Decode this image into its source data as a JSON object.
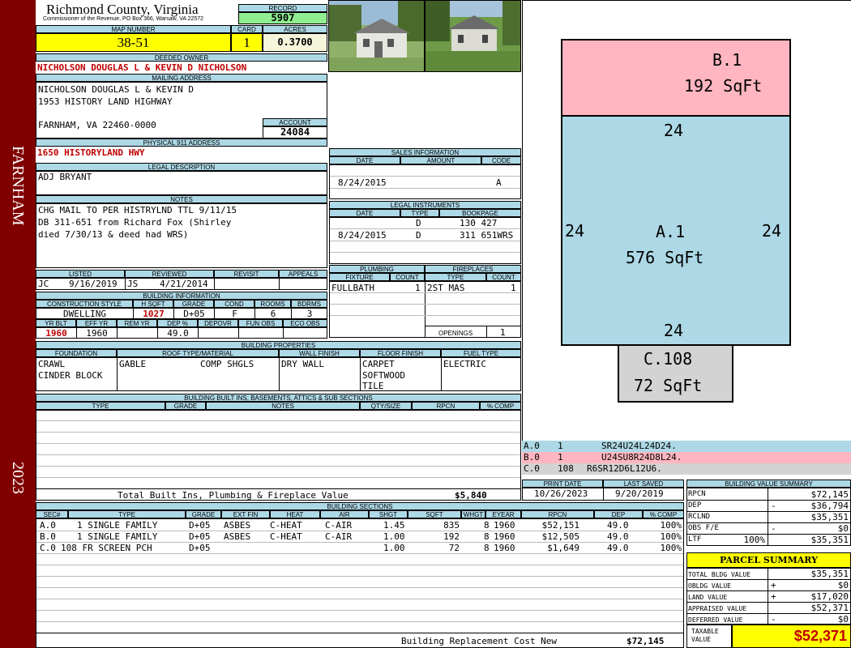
{
  "sidebar": {
    "town": "FARNHAM",
    "year": "2023"
  },
  "header": {
    "county": "Richmond County, Virginia",
    "commissioner": "Commissioner of the Revenue, PO Box 366, Warsaw, VA 22572",
    "record_label": "RECORD",
    "record": "5907",
    "map_number_label": "MAP NUMBER",
    "map_number": "38-51",
    "card_label": "CARD",
    "card": "1",
    "acres_label": "ACRES",
    "acres": "0.3700"
  },
  "owner": {
    "deeded_owner_label": "DEEDED OWNER",
    "deeded_owner": "NICHOLSON DOUGLAS L & KEVIN D NICHOLSON",
    "mailing_label": "MAILING ADDRESS",
    "mailing_lines": [
      "NICHOLSON DOUGLAS L & KEVIN D",
      "1953 HISTORY LAND HIGHWAY",
      "",
      "FARNHAM, VA 22460-0000"
    ],
    "account_label": "ACCOUNT",
    "account": "24084",
    "physical_label": "PHYSICAL 911 ADDRESS",
    "physical": "1650 HISTORYLAND HWY"
  },
  "legal": {
    "label": "LEGAL DESCRIPTION",
    "text": "ADJ BRYANT"
  },
  "notes": {
    "label": "NOTES",
    "lines": [
      "CHG MAIL TO PER HISTRYLND TTL 9/11/15",
      "DB 311-651 from Richard Fox (Shirley",
      "died 7/30/13 & deed had WRS)"
    ]
  },
  "review": {
    "listed_label": "LISTED",
    "reviewed_label": "REVIEWED",
    "revisit_label": "REVISIT",
    "appeals_label": "APPEALS",
    "listed_by": "JC",
    "listed_date": "9/16/2019",
    "reviewed_by": "JS",
    "reviewed_date": "4/21/2014"
  },
  "building_info": {
    "label": "BUILDING INFORMATION",
    "headers": [
      "CONSTRUCTION STYLE",
      "H SQFT",
      "GRADE",
      "COND",
      "ROOMS",
      "BDRMS"
    ],
    "style": "DWELLING",
    "hsqft": "1027",
    "grade": "D+05",
    "cond": "F",
    "rooms": "6",
    "bdrms": "3",
    "headers2": [
      "YR BLT",
      "EFF YR",
      "REM YR",
      "DEP %",
      "DEPOVR",
      "FUN OBS",
      "ECO OBS"
    ],
    "yr_blt": "1960",
    "eff_yr": "1960",
    "rem_yr": "",
    "dep_pct": "49.0"
  },
  "sales": {
    "label": "SALES INFORMATION",
    "headers": [
      "DATE",
      "AMOUNT",
      "CODE"
    ],
    "rows": [
      {
        "date": "8/24/2015",
        "amount": "",
        "code": "A"
      }
    ]
  },
  "instruments": {
    "label": "LEGAL INSTRUMENTS",
    "headers": [
      "DATE",
      "TYPE",
      "BOOKPAGE"
    ],
    "rows": [
      {
        "date": "",
        "type": "D",
        "book": "130 427"
      },
      {
        "date": "8/24/2015",
        "type": "D",
        "book": "311 651WRS"
      }
    ]
  },
  "plumbing": {
    "label": "PLUMBING",
    "headers": [
      "FIXTURE",
      "COUNT"
    ],
    "rows": [
      {
        "fixture": "FULLBATH",
        "count": "1"
      }
    ]
  },
  "fireplaces": {
    "label": "FIREPLACES",
    "headers": [
      "TYPE",
      "COUNT"
    ],
    "rows": [
      {
        "type": "2ST MAS",
        "count": "1"
      }
    ],
    "openings_label": "OPENINGS",
    "openings": "1"
  },
  "properties": {
    "label": "BUILDING PROPERTIES",
    "headers": [
      "FOUNDATION",
      "ROOF TYPE/MATERIAL",
      "WALL FINISH",
      "FLOOR FINISH",
      "FUEL TYPE"
    ],
    "foundation": [
      "CRAWL",
      "CINDER BLOCK"
    ],
    "roof_type": "GABLE",
    "roof_material": "COMP SHGLS",
    "wall": "DRY WALL",
    "floor": [
      "CARPET",
      "SOFTWOOD",
      "TILE"
    ],
    "fuel": "ELECTRIC"
  },
  "builtins": {
    "label": "BUILDING BUILT INS, BASEMENTS, ATTICS & SUB SECTIONS",
    "headers": [
      "TYPE",
      "GRADE",
      "NOTES",
      "QTY/SIZE",
      "RPCN",
      "% COMP"
    ],
    "total_label": "Total Built Ins, Plumbing & Fireplace Value",
    "total": "$5,840"
  },
  "print": {
    "print_label": "PRINT DATE",
    "saved_label": "LAST SAVED",
    "print_date": "10/26/2023",
    "last_saved": "9/20/2019"
  },
  "sketch": {
    "sections": [
      {
        "code": "B.1",
        "area": "192 SqFt",
        "color": "#ffb6c1"
      },
      {
        "code": "A.1",
        "area": "576 SqFt",
        "color": "#add8e6"
      },
      {
        "code": "C.108",
        "area": "72 SqFt",
        "color": "#d3d3d3"
      }
    ],
    "dims": {
      "top": "24",
      "left": "24",
      "right": "24",
      "bottom": "24"
    },
    "legend": [
      {
        "sec": "A.0",
        "n": "1",
        "desc": "SR24U24L24D24.",
        "color": "#add8e6"
      },
      {
        "sec": "B.0",
        "n": "1",
        "desc": "U24SU8R24D8L24.",
        "color": "#ffb6c1"
      },
      {
        "sec": "C.0",
        "n": "108",
        "desc": "R6SR12D6L12U6.",
        "color": "#d3d3d3"
      }
    ]
  },
  "sections": {
    "label": "BUILDING SECTIONS",
    "headers": [
      "SEC#",
      "TYPE",
      "GRADE",
      "EXT FIN",
      "HEAT",
      "AIR",
      "SHGT",
      "SQFT",
      "WHGT",
      "EYEAR",
      "RPCN",
      "DEP",
      "% COMP"
    ],
    "rows": [
      {
        "sec": "A.0",
        "type": "1 SINGLE FAMILY",
        "grade": "D+05",
        "ext": "ASBES",
        "heat": "C-HEAT",
        "air": "C-AIR",
        "shgt": "1.45",
        "sqft": "835",
        "whgt": "8",
        "eyear": "1960",
        "rpcn": "$52,151",
        "dep": "49.0",
        "comp": "100%"
      },
      {
        "sec": "B.0",
        "type": "1 SINGLE FAMILY",
        "grade": "D+05",
        "ext": "ASBES",
        "heat": "C-HEAT",
        "air": "C-AIR",
        "shgt": "1.00",
        "sqft": "192",
        "whgt": "8",
        "eyear": "1960",
        "rpcn": "$12,505",
        "dep": "49.0",
        "comp": "100%"
      },
      {
        "sec": "C.0",
        "type": "108 FR SCREEN PCH",
        "grade": "D+05",
        "ext": "",
        "heat": "",
        "air": "",
        "shgt": "1.00",
        "sqft": "72",
        "whgt": "8",
        "eyear": "1960",
        "rpcn": "$1,649",
        "dep": "49.0",
        "comp": "100%"
      }
    ],
    "replacement_label": "Building Replacement Cost New",
    "replacement": "$72,145"
  },
  "value_summary": {
    "label": "BUILDING VALUE SUMMARY",
    "rows": [
      {
        "label": "RPCN",
        "op": "",
        "pct": "",
        "value": "$72,145"
      },
      {
        "label": "DEP",
        "op": "-",
        "pct": "",
        "value": "$36,794"
      },
      {
        "label": "RCLND",
        "op": "",
        "pct": "",
        "value": "$35,351"
      },
      {
        "label": "OBS F/E",
        "op": "-",
        "pct": "",
        "value": "$0"
      },
      {
        "label": "LTF",
        "op": "",
        "pct": "100%",
        "value": "$35,351"
      }
    ]
  },
  "parcel": {
    "label": "PARCEL SUMMARY",
    "rows": [
      {
        "label": "TOTAL BLDG VALUE",
        "op": "",
        "value": "$35,351"
      },
      {
        "label": "OBLDG VALUE",
        "op": "+",
        "value": "$0"
      },
      {
        "label": "LAND VALUE",
        "op": "+",
        "value": "$17,020"
      },
      {
        "label": "APPRAISED VALUE",
        "op": "",
        "value": "$52,371"
      },
      {
        "label": "DEFERRED VALUE",
        "op": "-",
        "value": "$0"
      }
    ],
    "taxable_label": "TAXABLE VALUE",
    "taxable": "$52,371"
  },
  "colors": {
    "sidebar": "#800000",
    "header_fill": "#add8e6",
    "highlight": "#ffff00",
    "record_fill": "#90ee90",
    "red_text": "#c00000"
  }
}
